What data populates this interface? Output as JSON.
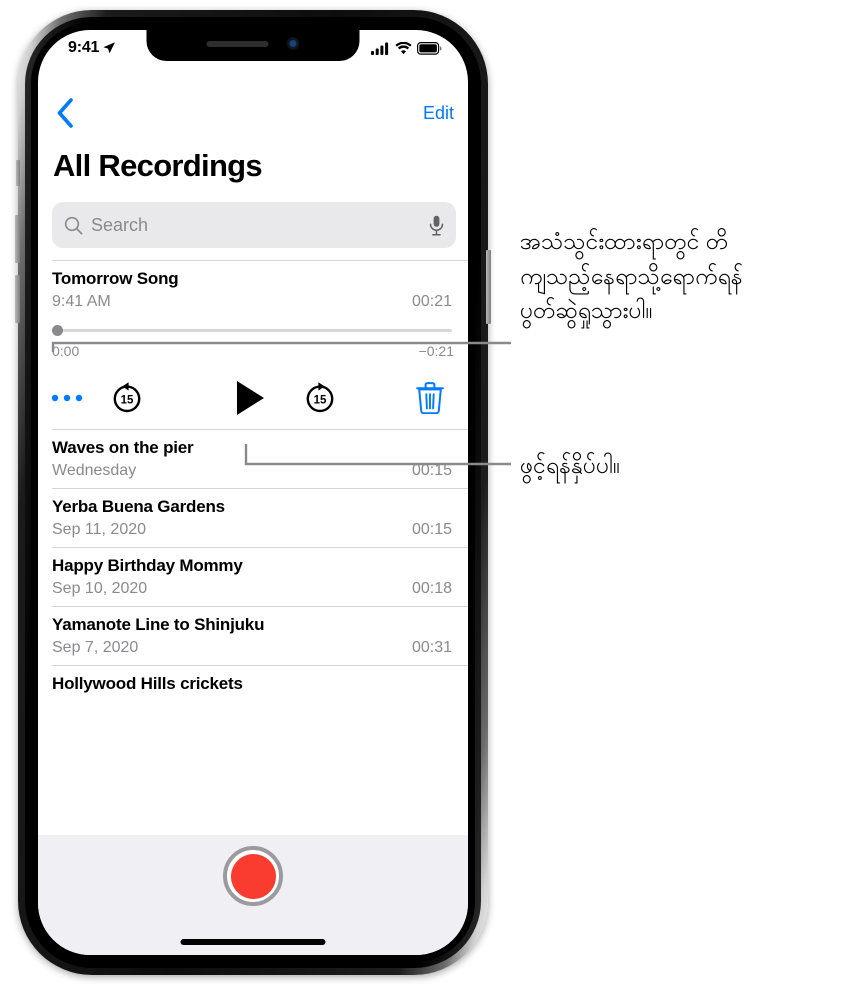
{
  "device": {
    "status_bar": {
      "time": "9:41",
      "location_icon": "location-arrow-icon",
      "cellular_icon": "cellular-bars-icon",
      "wifi_icon": "wifi-icon",
      "battery_icon": "battery-full-icon"
    },
    "home_indicator": "home-indicator"
  },
  "nav": {
    "back_icon": "chevron-left-icon",
    "edit_label": "Edit"
  },
  "header": {
    "title": "All Recordings"
  },
  "search": {
    "placeholder": "Search",
    "value": "",
    "search_icon": "search-icon",
    "dictate_icon": "microphone-icon"
  },
  "player": {
    "title": "Tomorrow Song",
    "date": "9:41 AM",
    "duration": "00:21",
    "elapsed": "0:00",
    "remaining": "−0:21",
    "progress_percent": 0,
    "controls": {
      "more_label": "•••",
      "more_name": "more-options-icon",
      "skip_back_label": "15",
      "skip_back_name": "skip-back-15-icon",
      "play_name": "play-icon",
      "skip_forward_label": "15",
      "skip_forward_name": "skip-forward-15-icon",
      "delete_name": "trash-icon"
    }
  },
  "recordings": [
    {
      "title": "Waves on the pier",
      "date": "Wednesday",
      "duration": "00:15"
    },
    {
      "title": "Yerba Buena Gardens",
      "date": "Sep 11, 2020",
      "duration": "00:15"
    },
    {
      "title": "Happy Birthday Mommy",
      "date": "Sep 10, 2020",
      "duration": "00:18"
    },
    {
      "title": "Yamanote Line to Shinjuku",
      "date": "Sep 7, 2020",
      "duration": "00:31"
    },
    {
      "title": "Hollywood Hills crickets",
      "date": "",
      "duration": ""
    }
  ],
  "record_bar": {
    "record_button_name": "record-button"
  },
  "annotations": [
    {
      "id": "scrubber-callout",
      "text": "အသံသွင်းထားရာတွင် တိ\nကျသည့်နေရာသို့ရောက်ရန်\nပွတ်ဆွဲရှုသွားပါ။"
    },
    {
      "id": "play-callout",
      "text": "ဖွင့်ရန်နှိပ်ပါ။"
    }
  ],
  "colors": {
    "accent_blue": "#007aff",
    "record_red": "#fa3b2f",
    "search_field": "#e9e9eb",
    "secondary_text": "#8a8a8e",
    "callout_line": "#8a8a8e",
    "record_bar_bg": "#f0f0f4"
  }
}
